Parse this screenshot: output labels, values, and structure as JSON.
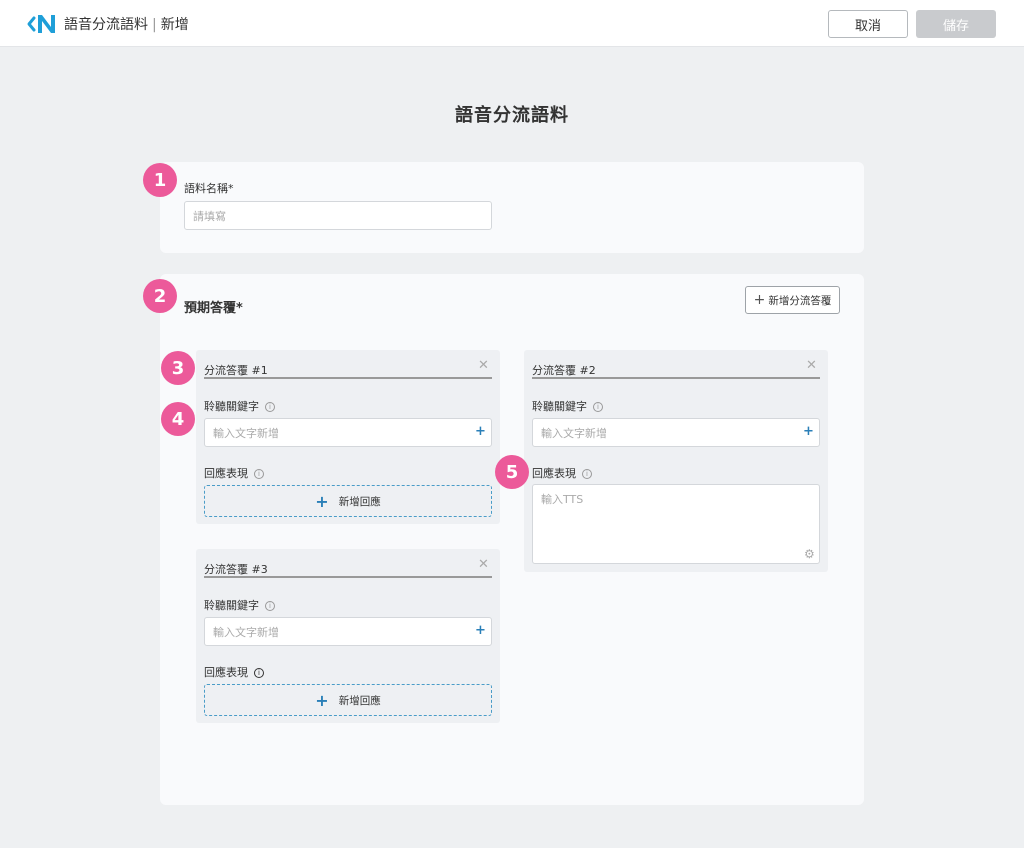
{
  "header": {
    "breadcrumb_title": "語音分流語料",
    "breadcrumb_sep": "|",
    "breadcrumb_action": "新增",
    "cancel_label": "取消",
    "save_label": "儲存"
  },
  "page": {
    "title": "語音分流語料"
  },
  "badges": [
    "1",
    "2",
    "3",
    "4",
    "5"
  ],
  "corpus_name": {
    "label": "語料名稱*",
    "placeholder": "請填寫"
  },
  "expected_reply": {
    "title": "預期答覆*",
    "add_branch_label": "新增分流答覆",
    "branches": [
      {
        "title": "分流答覆 #1",
        "keyword_label": "聆聽關鍵字",
        "keyword_placeholder": "輸入文字新增",
        "response_label": "回應表現",
        "add_response_label": "新增回應"
      },
      {
        "title": "分流答覆 #2",
        "keyword_label": "聆聽關鍵字",
        "keyword_placeholder": "輸入文字新增",
        "response_label": "回應表現",
        "tts_placeholder": "輸入TTS"
      },
      {
        "title": "分流答覆 #3",
        "keyword_label": "聆聽關鍵字",
        "keyword_placeholder": "輸入文字新增",
        "response_label": "回應表現",
        "add_response_label": "新增回應"
      }
    ]
  },
  "colors": {
    "accent_blue": "#2a7fb8",
    "badge_pink": "#ec5a9a",
    "logo_blue": "#1f9fd8",
    "save_disabled": "#c9cbce"
  },
  "icons": {
    "logo": "back-n-logo",
    "close": "close-icon",
    "info": "info-icon",
    "plus": "plus-icon",
    "settings": "gear-icon"
  }
}
